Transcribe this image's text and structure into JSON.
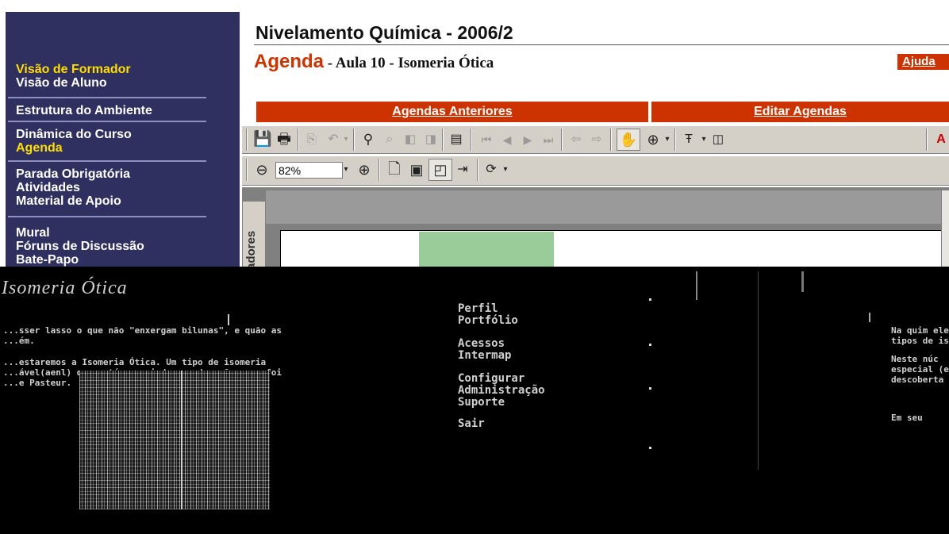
{
  "sidebar": {
    "items": [
      {
        "label": "Visão de Formador",
        "highlight": true
      },
      {
        "label": "Visão de Aluno",
        "highlight": false
      },
      {
        "label": "Estrutura do Ambiente",
        "highlight": false
      },
      {
        "label": "Dinâmica do Curso",
        "highlight": false
      },
      {
        "label": "Agenda",
        "highlight": true
      },
      {
        "label": "Parada Obrigatória",
        "highlight": false
      },
      {
        "label": "Atividades",
        "highlight": false
      },
      {
        "label": "Material de Apoio",
        "highlight": false
      },
      {
        "label": "Mural",
        "highlight": false
      },
      {
        "label": "Fóruns de Discussão",
        "highlight": false
      },
      {
        "label": "Bate-Papo",
        "highlight": false
      }
    ]
  },
  "header": {
    "course_title": "Nivelamento Química - 2006/2",
    "section": "Agenda",
    "subtitle": " - Aula 10 - Isomeria Ótica",
    "help": "Ajuda"
  },
  "tabs": {
    "previous": "Agendas Anteriores",
    "edit": "Editar Agendas"
  },
  "viewer": {
    "zoom_value": "82%",
    "side_tab": "adores"
  },
  "corrupted_region": {
    "title": "Isomeria Ótica",
    "paragraph_1": [
      "...sser lasso o que não \"enxergam bilunas\", e quão as",
      "...ém."
    ],
    "paragraph_2": [
      "...estaremos a Isomeria Ótica. Um tipo de isomeria",
      "...ável(aenl) que está associado a ordenação, que foi",
      "...e Pasteur."
    ],
    "menu": [
      "Perfil",
      "Portfólio",
      "Acessos",
      "Intermap",
      "Configurar",
      "Administração",
      "Suporte",
      "Sair"
    ],
    "right_text_1": [
      "Na quim ele",
      "tipos de iso"
    ],
    "right_text_2": [
      "Neste núc",
      "especial (ena",
      "descoberta p"
    ],
    "right_text_3": "Em seu"
  },
  "colors": {
    "sidebar_bg": "#303060",
    "accent": "#cc3300",
    "highlight": "#ffdd00",
    "toolbar_bg": "#d4d0c8"
  }
}
